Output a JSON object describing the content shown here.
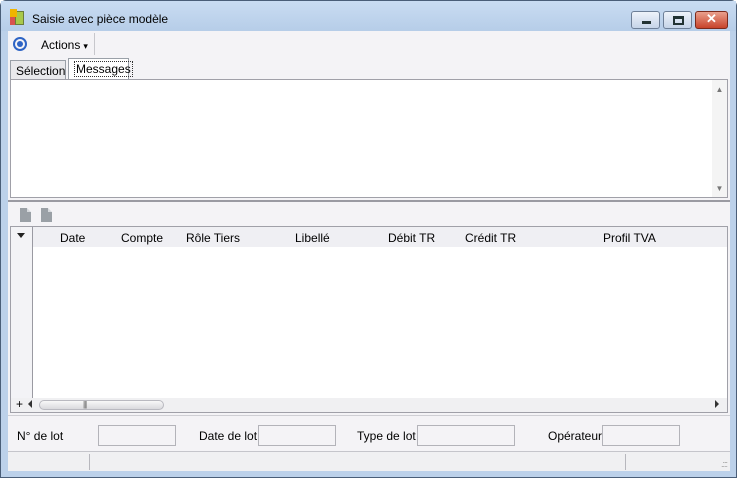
{
  "window": {
    "title": "Saisie avec pièce modèle",
    "close_glyph": "✕"
  },
  "toolbar": {
    "actions_label": "Actions",
    "actions_caret": "▾"
  },
  "tabs": [
    {
      "label": "Sélection",
      "selected": false
    },
    {
      "label": "Messages",
      "selected": true
    }
  ],
  "messages": {
    "scroll_up_glyph": "▲",
    "scroll_down_glyph": "▼"
  },
  "grid": {
    "columns": [
      "Date",
      "Compte",
      "Rôle Tiers",
      "Libellé",
      "Débit TR",
      "Crédit TR",
      "Profil TVA"
    ],
    "rows": [],
    "add_row_glyph": "+",
    "thumb_grip": "|||"
  },
  "form": {
    "lot_number_label": "N° de lot",
    "lot_number_value": "",
    "lot_date_label": "Date de lot",
    "lot_date_value": "",
    "lot_type_label": "Type de lot",
    "lot_type_value": "",
    "operator_label": "Opérateur",
    "operator_value": ""
  },
  "statusbar": {
    "grip": ".:::"
  },
  "colors": {
    "window_frame": "#bcd1ea",
    "close_button": "#c8432a",
    "accent_icon": "#2e64c5",
    "client_background": "#f4f3f6"
  }
}
